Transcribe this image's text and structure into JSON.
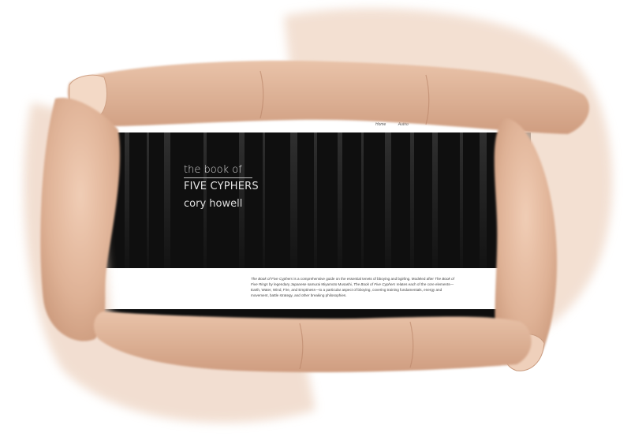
{
  "website": {
    "nav": [
      "Home",
      "Autho"
    ],
    "title_line1": "the book of",
    "title_line2": "FIVE CYPHERS",
    "author": "cory howell",
    "description": {
      "part1_italic": "The Book of Five Cyphers",
      "part2": " is a comprehensive guide on the essential tenets of bboying and bgirling. Modeled after ",
      "part3_italic": "The Book of Five Rings",
      "part4": " by legendary Japanese samurai Miyamoto Musashi, ",
      "part5_italic": "The Book of Five Cyphers",
      "part6": " relates each of the core elements—Earth, Water, Wind, Fire, and Emptiness—to a particular aspect of bboying, covering training fundamentals, energy and movement, battle strategy, and other breaking philosophies."
    }
  },
  "colors": {
    "hero_background": "#0f0f0f",
    "skin_light": "#e8c2a8",
    "skin_dark": "#c79477",
    "page_background": "#ffffff"
  }
}
